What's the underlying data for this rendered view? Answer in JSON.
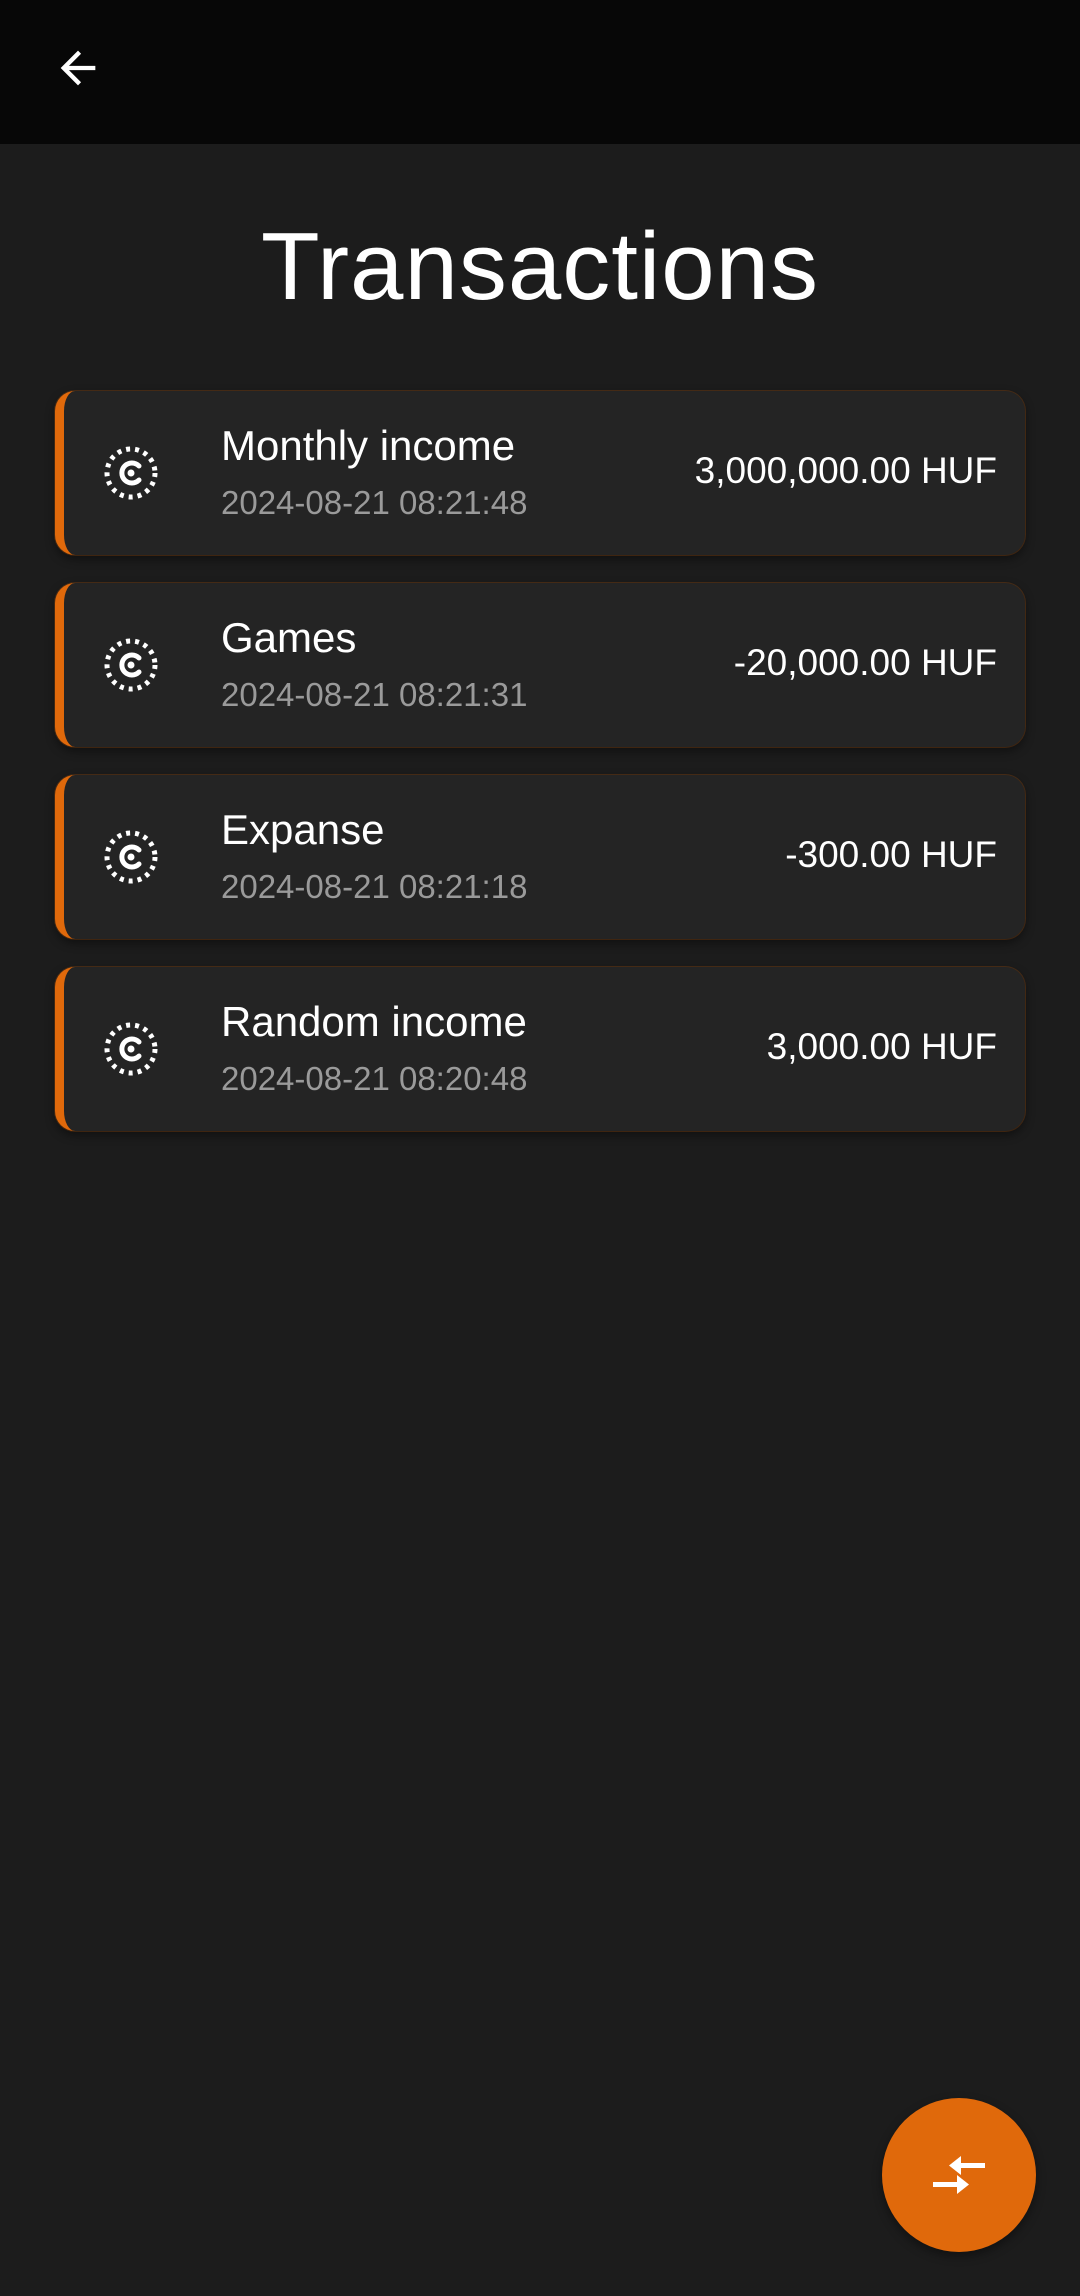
{
  "header": {
    "back_icon": "arrow-left-icon"
  },
  "page": {
    "title": "Transactions"
  },
  "colors": {
    "accent": "#e0690b",
    "background": "#1c1c1c",
    "card": "#242424",
    "topbar": "#070707",
    "muted_text": "#9a9a9a"
  },
  "transactions": [
    {
      "title": "Monthly income",
      "date": "2024-08-21 08:21:48",
      "amount": "3,000,000.00 HUF",
      "icon": "category-placeholder-icon"
    },
    {
      "title": "Games",
      "date": "2024-08-21 08:21:31",
      "amount": "-20,000.00 HUF",
      "icon": "category-placeholder-icon"
    },
    {
      "title": "Expanse",
      "date": "2024-08-21 08:21:18",
      "amount": "-300.00 HUF",
      "icon": "category-placeholder-icon"
    },
    {
      "title": "Random income",
      "date": "2024-08-21 08:20:48",
      "amount": "3,000.00 HUF",
      "icon": "category-placeholder-icon"
    }
  ],
  "fab": {
    "icon": "compare-arrows-icon"
  }
}
